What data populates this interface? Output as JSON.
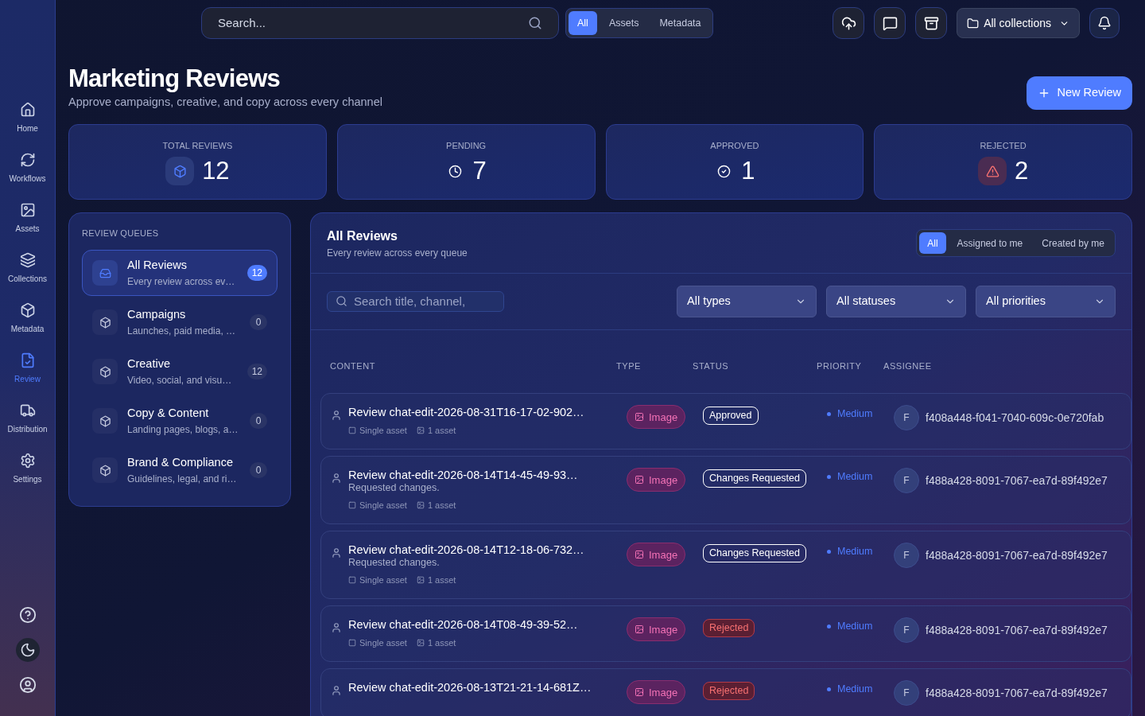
{
  "sidebar": {
    "items": [
      {
        "label": "Home",
        "selected": false
      },
      {
        "label": "Workflows",
        "selected": false
      },
      {
        "label": "Assets",
        "selected": false
      },
      {
        "label": "Collections",
        "selected": false
      },
      {
        "label": "Metadata",
        "selected": false
      },
      {
        "label": "Review",
        "selected": true
      },
      {
        "label": "Distribution",
        "selected": false
      },
      {
        "label": "Settings",
        "selected": false
      }
    ]
  },
  "topbar": {
    "search": {
      "placeholder": "Search..."
    },
    "scope_tabs": [
      {
        "label": "All",
        "selected": true
      },
      {
        "label": "Assets",
        "selected": false
      },
      {
        "label": "Metadata",
        "selected": false
      }
    ],
    "collections": "All collections"
  },
  "header": {
    "title": "Marketing Reviews",
    "subtitle": "Approve campaigns, creative, and copy across every channel",
    "new_button": "New Review"
  },
  "stats": [
    {
      "label": "TOTAL REVIEWS",
      "value": "12",
      "kind": "boxed"
    },
    {
      "label": "PENDING",
      "value": "7",
      "kind": "plain"
    },
    {
      "label": "APPROVED",
      "value": "1",
      "kind": "plain"
    },
    {
      "label": "REJECTED",
      "value": "2",
      "kind": "alert"
    }
  ],
  "queues": {
    "title": "REVIEW QUEUES",
    "items": [
      {
        "name": "All Reviews",
        "description": "Every review across ev…",
        "count": "12",
        "selected": true
      },
      {
        "name": "Campaigns",
        "description": "Launches, paid media, …",
        "count": "0",
        "selected": false
      },
      {
        "name": "Creative",
        "description": "Video, social, and visu…",
        "count": "12",
        "selected": false
      },
      {
        "name": "Copy & Content",
        "description": "Landing pages, blogs, a…",
        "count": "0",
        "selected": false
      },
      {
        "name": "Brand & Compliance",
        "description": "Guidelines, legal, and ri…",
        "count": "0",
        "selected": false
      }
    ]
  },
  "reviews": {
    "title": "All Reviews",
    "subtitle": "Every review across every queue",
    "tabs": [
      {
        "label": "All",
        "selected": true
      },
      {
        "label": "Assigned to me",
        "selected": false
      },
      {
        "label": "Created by me",
        "selected": false
      }
    ],
    "search": {
      "placeholder": "Search title, channel,"
    },
    "filters": [
      "All types",
      "All statuses",
      "All priorities"
    ],
    "columns": [
      "CONTENT",
      "TYPE",
      "STATUS",
      "PRIORITY",
      "ASSIGNEE"
    ],
    "rows": [
      {
        "title": "Review chat-edit-2026-08-31T16-17-02-902…",
        "meta": [
          "Single asset",
          "1 asset"
        ],
        "type": "Image",
        "status": {
          "label": "Approved",
          "kind": "approved"
        },
        "priority": "Medium",
        "initial": "F",
        "assignee": "f408a448-f041-7040-609c-0e720fab"
      },
      {
        "title": "Review chat-edit-2026-08-14T14-45-49-93…",
        "description": "Requested changes.",
        "meta": [
          "Single asset",
          "1 asset"
        ],
        "type": "Image",
        "status": {
          "label": "Changes Requested",
          "kind": "changes"
        },
        "priority": "Medium",
        "initial": "F",
        "assignee": "f488a428-8091-7067-ea7d-89f492e7"
      },
      {
        "title": "Review chat-edit-2026-08-14T12-18-06-732…",
        "description": "Requested changes.",
        "meta": [
          "Single asset",
          "1 asset"
        ],
        "type": "Image",
        "status": {
          "label": "Changes Requested",
          "kind": "changes"
        },
        "priority": "Medium",
        "initial": "F",
        "assignee": "f488a428-8091-7067-ea7d-89f492e7"
      },
      {
        "title": "Review chat-edit-2026-08-14T08-49-39-52…",
        "meta": [
          "Single asset",
          "1 asset"
        ],
        "type": "Image",
        "status": {
          "label": "Rejected",
          "kind": "rejected"
        },
        "priority": "Medium",
        "initial": "F",
        "assignee": "f488a428-8091-7067-ea7d-89f492e7"
      },
      {
        "title": "Review chat-edit-2026-08-13T21-21-14-681Z…",
        "type": "Image",
        "status": {
          "label": "Rejected",
          "kind": "rejected"
        },
        "priority": "Medium",
        "initial": "F",
        "assignee": "f488a428-8091-7067-ea7d-89f492e7"
      }
    ]
  }
}
